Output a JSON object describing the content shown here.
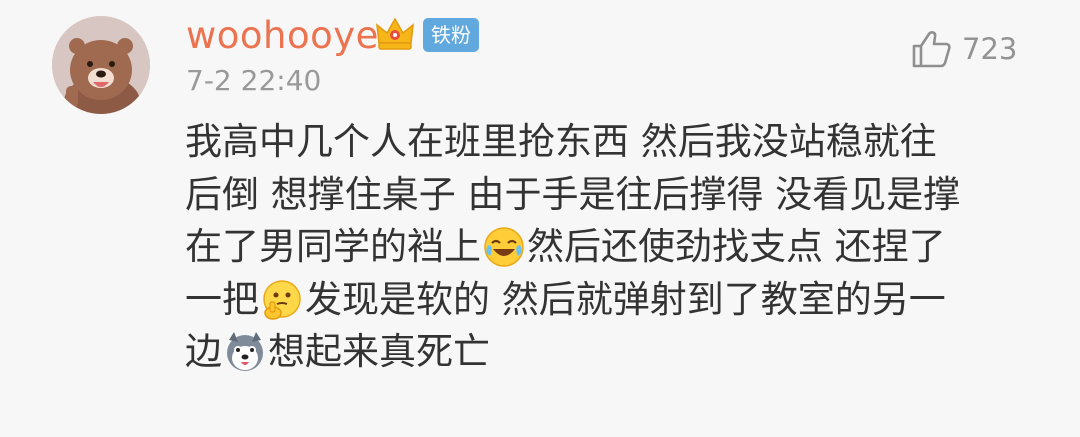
{
  "comment": {
    "user": {
      "name": "woohooye",
      "badge": "铁粉",
      "crown_icon": "crown-icon"
    },
    "timestamp": "7-2 22:40",
    "likes": "723",
    "content_lines": [
      {
        "parts": [
          "我高中几个人在班里抢东西 然后我没站稳就往"
        ]
      },
      {
        "parts": [
          "后倒 想撑住桌子 由于手是往后撑得 没看见是撑"
        ]
      },
      {
        "parts": [
          "在了男同学的裆上",
          "然后还使劲找支点 还捏了"
        ],
        "emoji": "laugh-cry-emoji-icon"
      },
      {
        "parts": [
          "一把",
          "发现是软的 然后就弹射到了教室的另一"
        ],
        "emoji": "thinking-emoji-icon"
      },
      {
        "parts": [
          "边",
          "想起来真死亡"
        ],
        "emoji": "husky-emoji-icon"
      }
    ]
  },
  "colors": {
    "username": "#eb7350",
    "badge_bg": "#60a8de",
    "meta_text": "#999999",
    "body_text": "#333333"
  }
}
